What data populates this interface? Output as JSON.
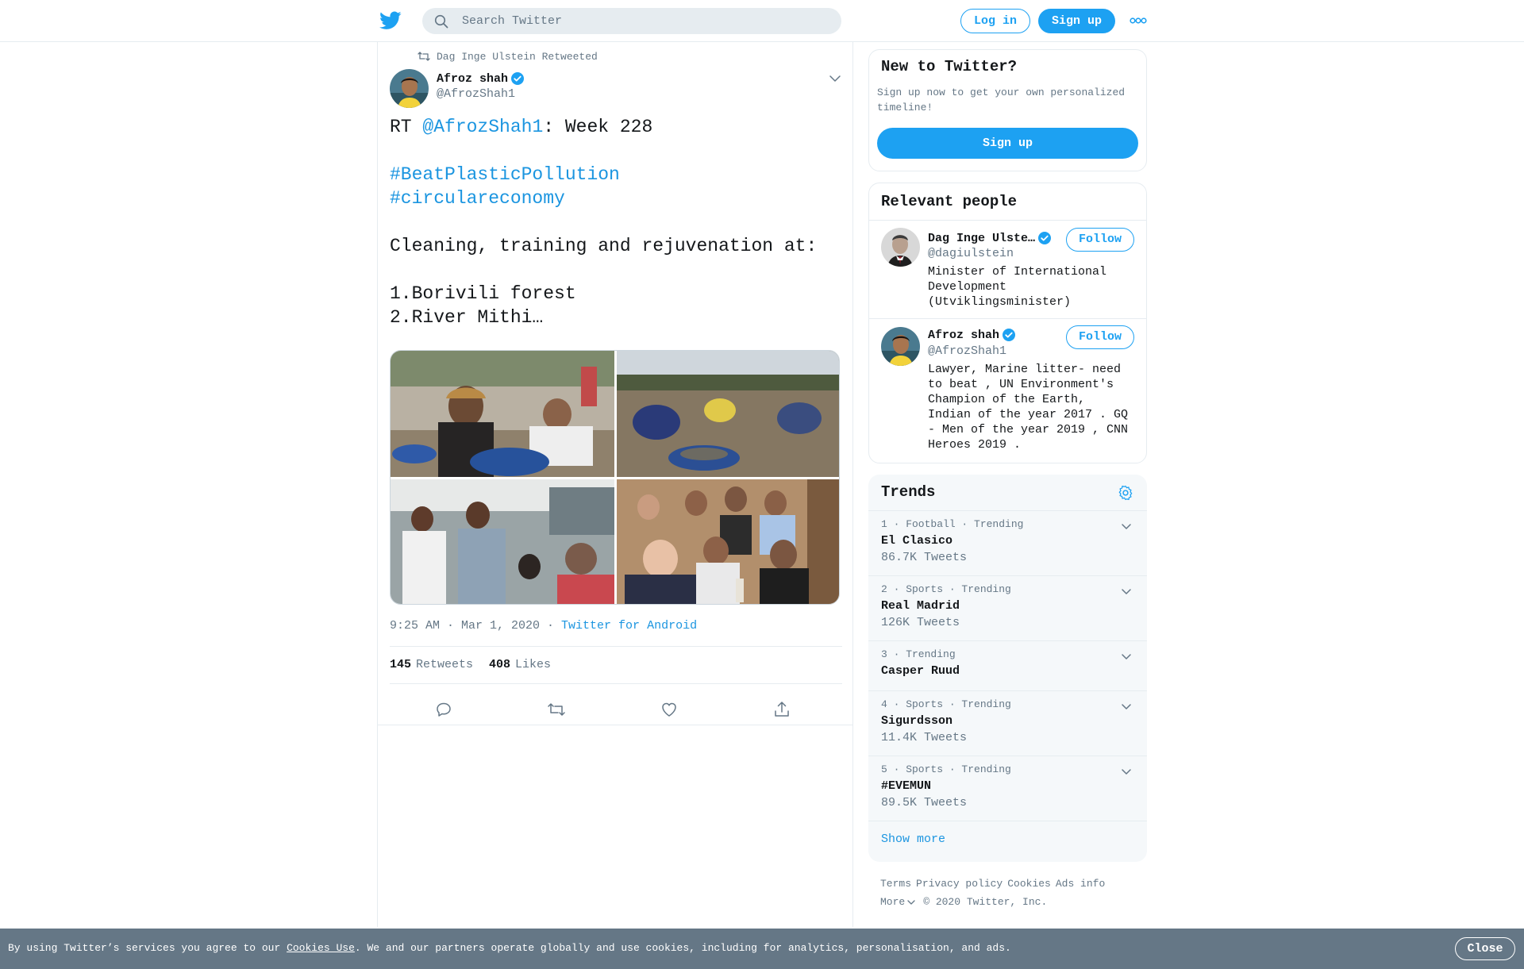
{
  "colors": {
    "brand": "#1da1f2",
    "link": "#1b95e0",
    "text": "#14171a",
    "muted": "#657786",
    "border": "#e6ecf0",
    "panel": "#f5f8fa",
    "cookie_bg": "#657786"
  },
  "topbar": {
    "logo_icon": "twitter-bird-icon",
    "search_placeholder": "Search Twitter",
    "login_label": "Log in",
    "signup_label": "Sign up",
    "more_icon": "more-dots-icon"
  },
  "tweet": {
    "retweet_context": "Dag Inge Ulstein Retweeted",
    "author_name": "Afroz shah",
    "author_handle": "@AfrozShah1",
    "text": {
      "prefix": "RT ",
      "mention": "@AfrozShah1",
      "after_mention": ": Week 228",
      "hashtag1": "#BeatPlasticPollution",
      "hashtag2": "#circulareconomy",
      "body": "Cleaning, training and rejuvenation at:",
      "line1": "1.Borivili forest",
      "line2": "2.River Mithi…"
    },
    "timestamp": "9:25 AM · Mar 1, 2020",
    "separator": " · ",
    "source": "Twitter for Android",
    "retweets_count": "145",
    "retweets_label": "Retweets",
    "likes_count": "408",
    "likes_label": "Likes"
  },
  "new_to_twitter": {
    "title": "New to Twitter?",
    "description": "Sign up now to get your own personalized timeline!",
    "button_label": "Sign up"
  },
  "relevant_people": {
    "title": "Relevant people",
    "people": [
      {
        "name": "Dag Inge Ulste…",
        "handle": "@dagiulstein",
        "bio": "Minister of International Development (Utviklingsminister)",
        "follow_label": "Follow"
      },
      {
        "name": "Afroz shah",
        "handle": "@AfrozShah1",
        "bio": "Lawyer, Marine litter- need to beat , UN Environment's Champion of the Earth, Indian of the year 2017 . GQ - Men of the year 2019 , CNN Heroes 2019 .",
        "follow_label": "Follow"
      }
    ]
  },
  "trends": {
    "title": "Trends",
    "items": [
      {
        "meta": "1 · Football · Trending",
        "name": "El Clasico",
        "count": "86.7K Tweets"
      },
      {
        "meta": "2 · Sports · Trending",
        "name": "Real Madrid",
        "count": "126K Tweets"
      },
      {
        "meta": "3 · Trending",
        "name": "Casper Ruud",
        "count": ""
      },
      {
        "meta": "4 · Sports · Trending",
        "name": "Sigurdsson",
        "count": "11.4K Tweets"
      },
      {
        "meta": "5 · Sports · Trending",
        "name": "#EVEMUN",
        "count": "89.5K Tweets"
      }
    ],
    "show_more": "Show more"
  },
  "footer": {
    "links": [
      "Terms",
      "Privacy policy",
      "Cookies",
      "Ads info"
    ],
    "more": "More",
    "copyright": "© 2020 Twitter, Inc."
  },
  "cookie_bar": {
    "text_before": "By using Twitter’s services you agree to our ",
    "link": "Cookies Use",
    "text_after": ". We and our partners operate globally and use cookies, including for analytics, personalisation, and ads.",
    "close_label": "Close"
  }
}
